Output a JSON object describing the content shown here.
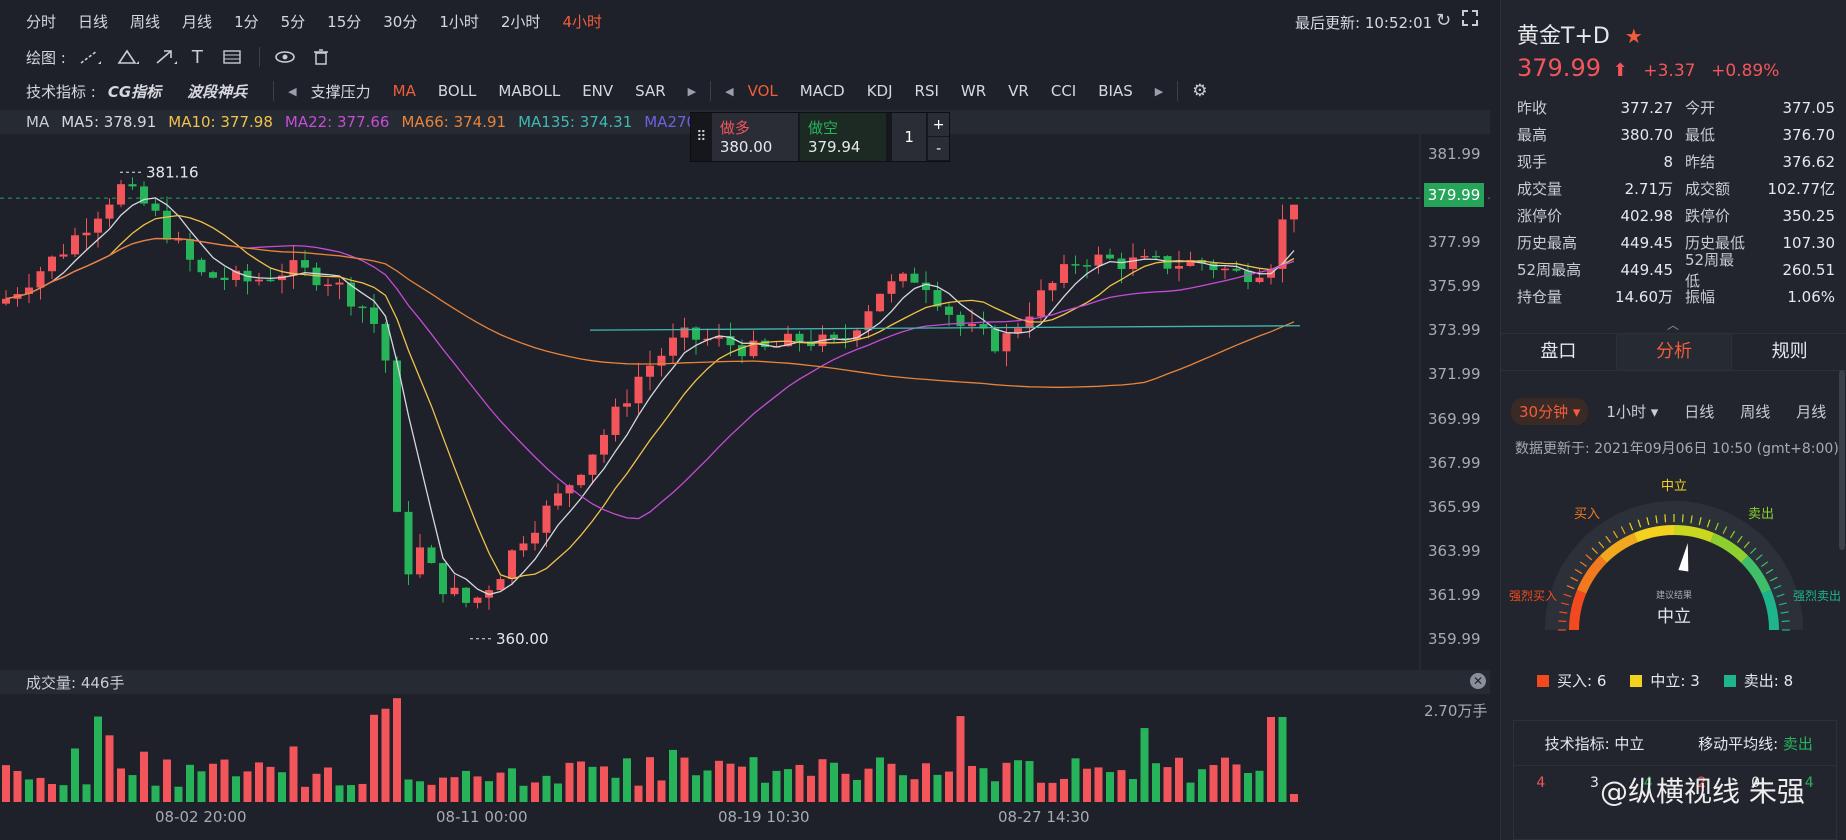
{
  "toolbar": {
    "periods": [
      "分时",
      "日线",
      "周线",
      "月线",
      "1分",
      "5分",
      "15分",
      "30分",
      "1小时",
      "2小时",
      "4小时"
    ],
    "active_period": "4小时",
    "last_update": "最后更新: 10:52:01",
    "draw_label": "绘图 :",
    "indicator_label": "技术指标 :",
    "cg_indicator": "CG指标",
    "wave_indicator": "波段神兵",
    "main_indicators": [
      "支撑压力",
      "MA",
      "BOLL",
      "MABOLL",
      "ENV",
      "SAR"
    ],
    "active_main": "MA",
    "sub_indicators": [
      "VOL",
      "MACD",
      "KDJ",
      "RSI",
      "WR",
      "VR",
      "CCI",
      "BIAS"
    ],
    "active_sub": "VOL"
  },
  "ma_bar": {
    "title": "MA",
    "items": [
      {
        "label": "MA5: 378.91",
        "color": "#d6d8dd"
      },
      {
        "label": "MA10: 377.98",
        "color": "#f0c24b"
      },
      {
        "label": "MA22: 377.66",
        "color": "#c64cd8"
      },
      {
        "label": "MA66: 374.91",
        "color": "#e8843a"
      },
      {
        "label": "MA135: 374.31",
        "color": "#3fb9b0"
      },
      {
        "label": "MA270:",
        "color": "#6c62e0"
      }
    ]
  },
  "order": {
    "buy_label": "做多",
    "buy_price": "380.00",
    "sell_label": "做空",
    "sell_price": "379.94",
    "qty": "1",
    "plus": "+",
    "minus": "-"
  },
  "price_axis": [
    "381.99",
    "379.99",
    "377.99",
    "375.99",
    "373.99",
    "371.99",
    "369.99",
    "367.99",
    "365.99",
    "363.99",
    "361.99",
    "359.99"
  ],
  "current_price_tag": "379.99",
  "high_mark": "381.16",
  "low_mark": "360.00",
  "volume_bar": {
    "label": "成交量: 446手",
    "axis_label": "2.70万手"
  },
  "x_axis": [
    "08-02 20:00",
    "08-11 00:00",
    "08-19 10:30",
    "08-27 14:30"
  ],
  "right": {
    "title": "黄金T+D",
    "price": "379.99",
    "change": "+3.37",
    "change_pct": "+0.89%",
    "stats": [
      [
        "昨收",
        "377.27",
        "今开",
        "377.05"
      ],
      [
        "最高",
        "380.70",
        "最低",
        "376.70"
      ],
      [
        "现手",
        "8",
        "昨结",
        "376.62"
      ],
      [
        "成交量",
        "2.71万",
        "成交额",
        "102.77亿"
      ],
      [
        "涨停价",
        "402.98",
        "跌停价",
        "350.25"
      ],
      [
        "历史最高",
        "449.45",
        "历史最低",
        "107.30"
      ],
      [
        "52周最高",
        "449.45",
        "52周最低",
        "260.51"
      ],
      [
        "持仓量",
        "14.60万",
        "振幅",
        "1.06%"
      ]
    ],
    "tabs": [
      "盘口",
      "分析",
      "规则"
    ],
    "active_tab": "分析",
    "periods": [
      "30分钟",
      "1小时",
      "日线",
      "周线",
      "月线"
    ],
    "update_text": "数据更新于: 2021年09月06日 10:50 (gmt+8:00)",
    "gauge": {
      "neutral_top": "中立",
      "buy": "买入",
      "sell": "卖出",
      "strong_buy": "强烈买入",
      "strong_sell": "强烈卖出",
      "advice_label": "建议结果",
      "result": "中立",
      "needle_value": 0.55
    },
    "legend": [
      {
        "label": "买入: 6",
        "color": "#f24a1e"
      },
      {
        "label": "中立: 3",
        "color": "#f2d21e"
      },
      {
        "label": "卖出: 8",
        "color": "#1eb48c"
      }
    ],
    "summary": {
      "tech_label": "技术指标:",
      "tech_value": "中立",
      "ma_label": "移动平均线:",
      "ma_value": "卖出"
    },
    "watermark": "@纵横视线 朱强"
  },
  "colors": {
    "up": "#f2555a",
    "down": "#26b35a",
    "accent": "#f25c3b"
  }
}
